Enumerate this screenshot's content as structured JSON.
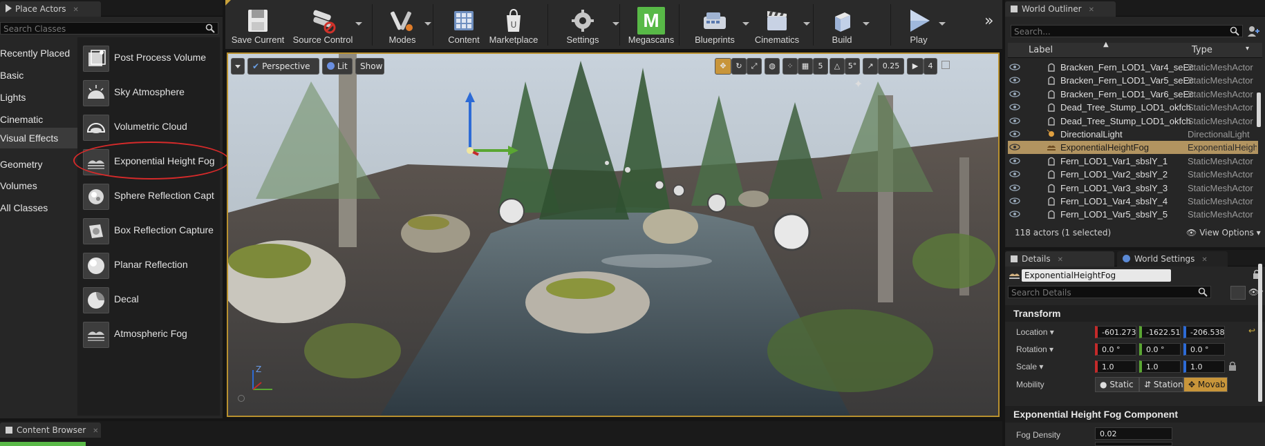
{
  "place_actors": {
    "tab_title": "Place Actors",
    "search_placeholder": "Search Classes",
    "categories": [
      {
        "label": "Recently Placed"
      },
      {
        "label": "Basic"
      },
      {
        "label": "Lights"
      },
      {
        "label": "Cinematic"
      },
      {
        "label": "Visual Effects"
      },
      {
        "label": "Geometry"
      },
      {
        "label": "Volumes"
      },
      {
        "label": "All Classes"
      }
    ],
    "items": [
      {
        "label": "Post Process Volume"
      },
      {
        "label": "Sky Atmosphere"
      },
      {
        "label": "Volumetric Cloud"
      },
      {
        "label": "Exponential Height Fog"
      },
      {
        "label": "Sphere Reflection Capt"
      },
      {
        "label": "Box Reflection Capture"
      },
      {
        "label": "Planar Reflection"
      },
      {
        "label": "Decal"
      },
      {
        "label": "Atmospheric Fog"
      }
    ]
  },
  "toolbar": {
    "buttons": [
      {
        "label": "Save Current",
        "icon": "save-icon"
      },
      {
        "label": "Source Control",
        "icon": "source-control-icon"
      },
      {
        "label": "Modes",
        "icon": "modes-icon"
      },
      {
        "label": "Content",
        "icon": "content-icon"
      },
      {
        "label": "Marketplace",
        "icon": "marketplace-icon"
      },
      {
        "label": "Settings",
        "icon": "settings-icon"
      },
      {
        "label": "Megascans",
        "icon": "megascans-icon"
      },
      {
        "label": "Blueprints",
        "icon": "blueprints-icon"
      },
      {
        "label": "Cinematics",
        "icon": "cinematics-icon"
      },
      {
        "label": "Build",
        "icon": "build-icon"
      },
      {
        "label": "Play",
        "icon": "play-icon"
      }
    ],
    "megascans_letter": "M",
    "overflow": "»"
  },
  "viewport": {
    "perspective_label": "Perspective",
    "lit_label": "Lit",
    "show_label": "Show",
    "grid_value": "5",
    "rotation_snap": "5°",
    "scale_snap": "0.25",
    "camera_speed": "4",
    "axis_z": "Z"
  },
  "outliner": {
    "tab_title": "World Outliner",
    "search_placeholder": "Search...",
    "col_label": "Label",
    "col_type": "Type",
    "rows": [
      {
        "label": "Bracken_Fern_LOD1_Var4_seEc",
        "type": "StaticMeshActor",
        "selected": false
      },
      {
        "label": "Bracken_Fern_LOD1_Var5_seEc",
        "type": "StaticMeshActor",
        "selected": false
      },
      {
        "label": "Bracken_Fern_LOD1_Var6_seEc",
        "type": "StaticMeshActor",
        "selected": false
      },
      {
        "label": "Dead_Tree_Stump_LOD1_okfch",
        "type": "StaticMeshActor",
        "selected": false
      },
      {
        "label": "Dead_Tree_Stump_LOD1_okfch",
        "type": "StaticMeshActor",
        "selected": false
      },
      {
        "label": "DirectionalLight",
        "type": "DirectionalLight",
        "selected": false
      },
      {
        "label": "ExponentialHeightFog",
        "type": "ExponentialHeigh",
        "selected": true
      },
      {
        "label": "Fern_LOD1_Var1_sbslY_1",
        "type": "StaticMeshActor",
        "selected": false
      },
      {
        "label": "Fern_LOD1_Var2_sbslY_2",
        "type": "StaticMeshActor",
        "selected": false
      },
      {
        "label": "Fern_LOD1_Var3_sbslY_3",
        "type": "StaticMeshActor",
        "selected": false
      },
      {
        "label": "Fern_LOD1_Var4_sbslY_4",
        "type": "StaticMeshActor",
        "selected": false
      },
      {
        "label": "Fern_LOD1_Var5_sbslY_5",
        "type": "StaticMeshActor",
        "selected": false
      }
    ],
    "status": "118 actors (1 selected)",
    "view_options": "View Options"
  },
  "details": {
    "tab_title": "Details",
    "world_settings_tab": "World Settings",
    "name_value": "ExponentialHeightFog",
    "search_placeholder": "Search Details",
    "transform_header": "Transform",
    "location_label": "Location",
    "rotation_label": "Rotation",
    "scale_label": "Scale",
    "mobility_label": "Mobility",
    "location": [
      "-601.273",
      "-1622.51",
      "-206.538"
    ],
    "rotation": [
      "0.0 °",
      "0.0 °",
      "0.0 °"
    ],
    "scale": [
      "1.0",
      "1.0",
      "1.0"
    ],
    "mobility_options": [
      "Static",
      "Station",
      "Movab"
    ],
    "fog_header": "Exponential Height Fog Component",
    "fog_density_label": "Fog Density",
    "fog_density_value": "0.02"
  },
  "content_browser": {
    "tab_title": "Content Browser"
  }
}
